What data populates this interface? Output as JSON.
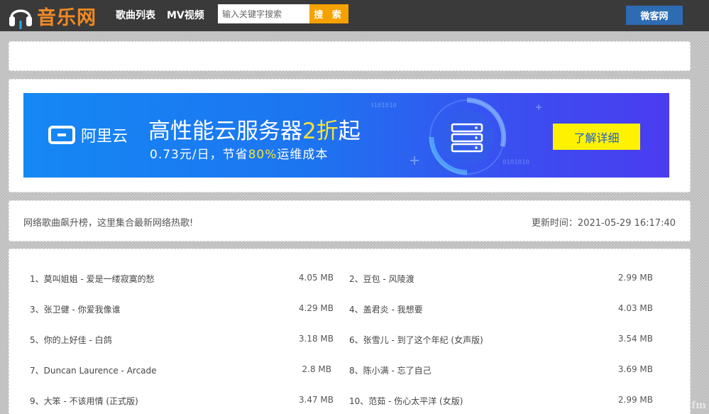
{
  "header": {
    "logo_text": "音乐网",
    "nav": [
      "歌曲列表",
      "MV视频"
    ],
    "search_placeholder": "输入关键字搜索",
    "search_button": "搜 索",
    "right_button": "微客网"
  },
  "ad": {
    "brand": "阿里云",
    "headline_prefix": "高性能云服务器",
    "headline_highlight": "2折",
    "headline_suffix": "起",
    "sub_prefix": "0.73元/日，节省",
    "sub_highlight": "80%",
    "sub_suffix": "运维成本",
    "cta": "了解详细",
    "deco_text": [
      "0101010",
      "0101010"
    ]
  },
  "info": {
    "description": "网络歌曲飙升榜，这里集合最新网络热歌!",
    "update_time": "更新时间：2021-05-29 16:17:40"
  },
  "songs": [
    {
      "title": "1、莫叫姐姐 - 爱是一缕寂寞的愁",
      "size": "4.05 MB"
    },
    {
      "title": "2、豆包 - 风陵渡",
      "size": "2.99 MB"
    },
    {
      "title": "3、张卫健 - 你爱我像谁",
      "size": "4.29 MB"
    },
    {
      "title": "4、盖君炎 - 我想要",
      "size": "4.03 MB"
    },
    {
      "title": "5、你的上好佳 - 白鸽",
      "size": "3.18 MB"
    },
    {
      "title": "6、张雪儿 - 到了这个年纪 (女声版)",
      "size": "3.54 MB"
    },
    {
      "title": "7、Duncan Laurence - Arcade",
      "size": "2.8 MB"
    },
    {
      "title": "8、陈小满 - 忘了自己",
      "size": "3.69 MB"
    },
    {
      "title": "9、大笨 - 不该用情 (正式版)",
      "size": "3.47 MB"
    },
    {
      "title": "10、范茹 - 伤心太平洋 (女版)",
      "size": "2.99 MB"
    }
  ],
  "colors": {
    "topbar": "#3a3a3a",
    "logo": "#f08a24",
    "search_button": "#f5a200",
    "right_button": "#2d6cb3",
    "ad_cta": "#fff200"
  },
  "icons": {
    "logo": "headphones-icon",
    "ad_brand": "aliyun-logo-icon",
    "ad_server": "server-icon"
  },
  "watermark": "fm"
}
